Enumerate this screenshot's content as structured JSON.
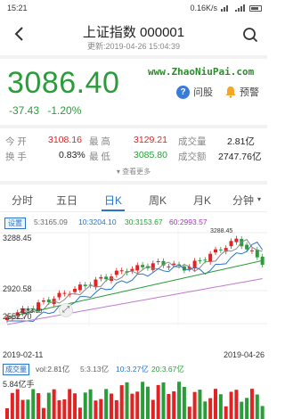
{
  "status_bar": {
    "time": "15:21",
    "speed": "0.16K/s"
  },
  "header": {
    "title": "上证指数 000001",
    "subtitle": "更新:2019-04-26 15:04:39"
  },
  "quote": {
    "price": "3086.40",
    "change": "-37.43",
    "change_pct": "-1.20%",
    "watermark": "www.ZhaoNiuPai.com",
    "ask_label": "问股",
    "alert_label": "预警"
  },
  "stats": {
    "open_label": "今 开",
    "open": "3108.16",
    "high_label": "最 高",
    "high": "3129.21",
    "volume_label": "成交量",
    "volume": "2.81亿",
    "turnover_label": "换 手",
    "turnover": "0.83%",
    "low_label": "最 低",
    "low": "3085.80",
    "amount_label": "成交额",
    "amount": "2747.76亿",
    "more_label": "查看更多"
  },
  "tabs": [
    {
      "label": "分时"
    },
    {
      "label": "五日"
    },
    {
      "label": "日K"
    },
    {
      "label": "周K"
    },
    {
      "label": "月K"
    },
    {
      "label": "分钟"
    }
  ],
  "ma": {
    "setting_label": "设置",
    "ma5": "5:3165.09",
    "ma10": "10:3204.10",
    "ma30": "30:3153.67",
    "ma60": "60:2993.57"
  },
  "chart_labels": {
    "y_top": "3288.45",
    "y_mid": "2920.58",
    "y_low": "2552.70",
    "peak_mark": "3288.45",
    "low_mark": "2553.10",
    "date_start": "2019-02-11",
    "date_end": "2019-04-26"
  },
  "volume": {
    "button_label": "成交量",
    "vol": "vol:2.81亿",
    "ma5": "5:3.13亿",
    "ma10": "10:3.27亿",
    "ma20": "20:3.67亿",
    "scale": "5.84亿手"
  },
  "colors": {
    "up": "#e02424",
    "down": "#2a9d3a",
    "accent": "#2a73c8"
  }
}
